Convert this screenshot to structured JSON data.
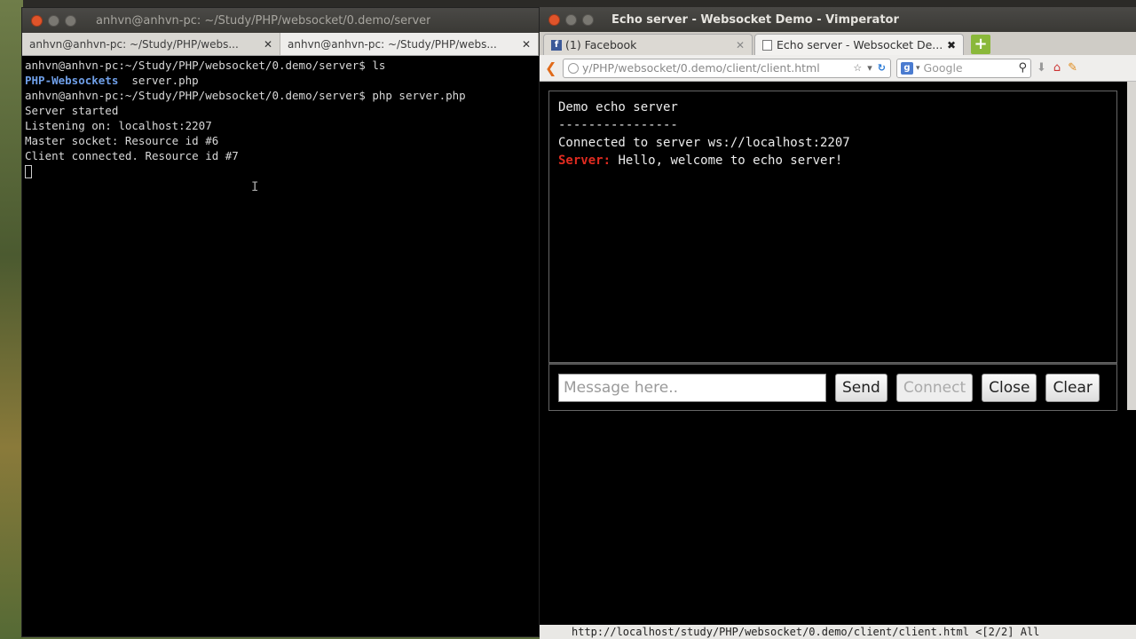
{
  "terminal": {
    "title": "anhvn@anhvn-pc: ~/Study/PHP/websocket/0.demo/server",
    "tabs": [
      {
        "label": "anhvn@anhvn-pc: ~/Study/PHP/webs..."
      },
      {
        "label": "anhvn@anhvn-pc: ~/Study/PHP/webs..."
      }
    ],
    "lines": [
      "anhvn@anhvn-pc:~/Study/PHP/websocket/0.demo/server$ ls",
      "",
      "anhvn@anhvn-pc:~/Study/PHP/websocket/0.demo/server$ php server.php",
      "Server started",
      "Listening on: localhost:2207",
      "Master socket: Resource id #6",
      "Client connected. Resource id #7"
    ],
    "ls_dir": "PHP-Websockets",
    "ls_file": "  server.php"
  },
  "browser": {
    "title": "Echo server - Websocket Demo - Vimperator",
    "tabs": [
      {
        "label": "(1) Facebook"
      },
      {
        "label": "Echo server - Websocket De..."
      }
    ],
    "url": "y/PHP/websocket/0.demo/client/client.html",
    "search_placeholder": "Google",
    "console": {
      "heading": "Demo echo server",
      "divider": "----------------",
      "connected": "Connected to server ws://localhost:2207",
      "server_label": "Server:",
      "server_message": " Hello, welcome to echo server!"
    },
    "input_placeholder": "Message here..",
    "buttons": {
      "send": "Send",
      "connect": "Connect",
      "close": "Close",
      "clear": "Clear"
    },
    "status": "http://localhost/study/PHP/websocket/0.demo/client/client.html <[2/2] All"
  }
}
